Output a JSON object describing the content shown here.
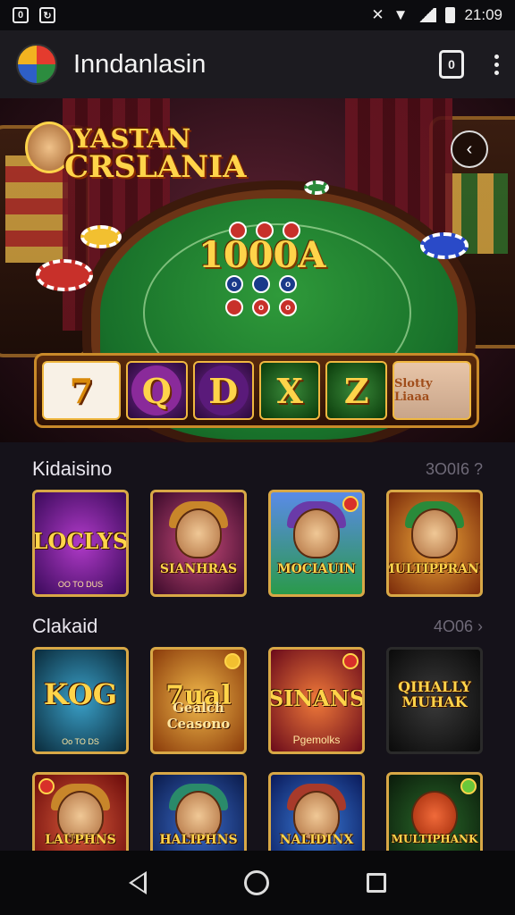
{
  "status_bar": {
    "left_icons": [
      "sim-icon",
      "notification-icon"
    ],
    "left_glyphs": [
      "0",
      "↻"
    ],
    "time": "21:09",
    "right_icons": [
      "mute-icon",
      "wifi-icon",
      "signal-icon",
      "battery-icon"
    ]
  },
  "app_bar": {
    "title": "Inndanlasin",
    "device_glyph": "0",
    "actions": [
      "device-icon",
      "more-vert-icon"
    ]
  },
  "hero": {
    "logo_line1": "YASTAN",
    "logo_line2": "CRSLANIA",
    "amount": "1000A",
    "back_glyph": "‹",
    "reels": [
      "7",
      "Q",
      "D",
      "X",
      "Z",
      "Slotty Liaaa"
    ],
    "table_row1": [
      "",
      "",
      ""
    ],
    "table_row2": [
      "o",
      "",
      "o"
    ],
    "table_row3": [
      "",
      "o",
      "o"
    ]
  },
  "section1": {
    "title": "Kidaisino",
    "count": "3O0I6 ?",
    "tiles": [
      {
        "label": "LOCLYS",
        "sub": "OO TO DUS",
        "colors": [
          "#8a2aa8",
          "#3a0a5a"
        ]
      },
      {
        "label": "SIANHRAS",
        "sub": "",
        "colors": [
          "#b03a6a",
          "#3a0a2a"
        ]
      },
      {
        "label": "MOCIAUIN",
        "sub": "",
        "colors": [
          "#4a7ad8",
          "#2a8a4a"
        ]
      },
      {
        "label": "MULTIPPRANS",
        "sub": "",
        "colors": [
          "#e0892a",
          "#7a2a0a"
        ]
      }
    ]
  },
  "section2": {
    "title": "Clakaid",
    "count": "4O06 ›",
    "tiles": [
      {
        "label": "KOG",
        "sub": "Oo TO DS",
        "colors": [
          "#2a7a9a",
          "#0a2a3a"
        ]
      },
      {
        "label": "7ual",
        "sub": "Gealch Ceasono",
        "colors": [
          "#e8a83a",
          "#8a3a0a"
        ]
      },
      {
        "label": "SINANS",
        "sub": "Pgemolks",
        "colors": [
          "#e05a2a",
          "#6a0a1a"
        ]
      },
      {
        "label": "QIHALLY MUHAK",
        "sub": "",
        "colors": [
          "#2a2a2a",
          "#0a0a0a"
        ]
      }
    ]
  },
  "section3": {
    "tiles": [
      {
        "label": "LAUPHNS",
        "colors": [
          "#c84a2a",
          "#6a0a0a"
        ]
      },
      {
        "label": "HALIPHNS",
        "colors": [
          "#2a5aa8",
          "#0a1a4a"
        ]
      },
      {
        "label": "NALIDINX",
        "colors": [
          "#2a6ac8",
          "#0a1a5a"
        ]
      },
      {
        "label": "MULTIPHANK",
        "colors": [
          "#2a6a2a",
          "#0a1a0a"
        ]
      }
    ]
  },
  "nav_bar": {
    "buttons": [
      "back-icon",
      "home-icon",
      "recents-icon"
    ]
  }
}
